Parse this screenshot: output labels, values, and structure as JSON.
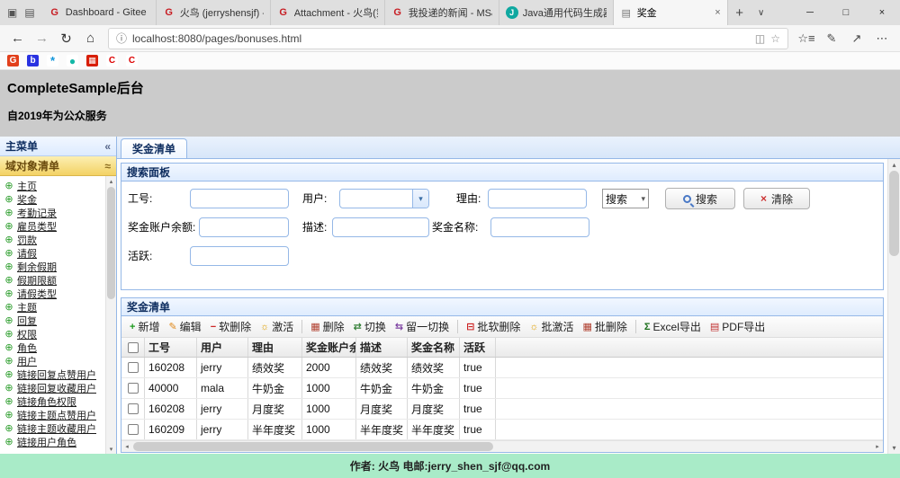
{
  "colors": {
    "accent_blue": "#95B8E7",
    "panel_header_bg": "#E0ECFF",
    "accordion_selected_bg": "#F3D264",
    "footer_bg": "#A9EBC8",
    "gitee_red": "#C71D23",
    "tree_icon_green": "#2E9E2E"
  },
  "icons": {
    "tab_preview": "▣",
    "set_aside": "▤",
    "new_tab": "+",
    "tab_menu": "∨",
    "minimize": "─",
    "maximize": "□",
    "close": "×",
    "back": "←",
    "forward": "→",
    "refresh": "↻",
    "home": "⌂",
    "info": "ⓘ",
    "reading_view": "◫",
    "star": "☆",
    "hub": "☆≡",
    "ink": "✎",
    "share": "↗",
    "more": "⋯",
    "collapse_left": "«",
    "accordion_tool": "≈",
    "tree_node": "⊕",
    "combo_arrow": "▾",
    "select_arrow": "▾",
    "clear": "×",
    "scroll_up": "▴",
    "scroll_down": "▾",
    "scroll_left": "◂",
    "scroll_right": "▸"
  },
  "browser": {
    "tabs": [
      {
        "favicon": "G",
        "title": "Dashboard - Gitee"
      },
      {
        "favicon": "G",
        "title": "火鸟 (jerryshensjf) - Git"
      },
      {
        "favicon": "G",
        "title": "Attachment - 火鸟(第三"
      },
      {
        "favicon": "G",
        "title": "我投递的新闻 - MS&A("
      },
      {
        "favicon": "J",
        "title": "Java通用代码生成器光"
      },
      {
        "favicon": "▤",
        "title": "奖金"
      }
    ],
    "url": "localhost:8080/pages/bonuses.html",
    "favorites": [
      "G",
      "b",
      "*",
      "●",
      "▦",
      "C",
      "C"
    ]
  },
  "page": {
    "header": {
      "title": "CompleteSample后台",
      "subtitle": "自2019年为公众服务"
    },
    "sidebar": {
      "panel_title": "主菜单",
      "accordion_title": "域对象清单",
      "items": [
        "主页",
        "奖金",
        "考勤记录",
        "雇员类型",
        "罚款",
        "请假",
        "剩余假期",
        "假期限额",
        "请假类型",
        "主题",
        "回复",
        "权限",
        "角色",
        "用户",
        "链接回复点赞用户",
        "链接回复收藏用户",
        "链接角色权限",
        "链接主题点赞用户",
        "链接主题收藏用户",
        "链接用户角色"
      ]
    },
    "main": {
      "tab_label": "奖金清单",
      "search": {
        "title": "搜索面板",
        "labels": {
          "emp_no": "工号:",
          "user": "用户:",
          "reason": "理由:",
          "balance": "奖金账户余额:",
          "description": "描述:",
          "bonus_name": "奖金名称:",
          "active": "活跃:"
        },
        "mode_select_value": "搜索",
        "search_button": "搜索",
        "clear_button": "清除"
      },
      "grid": {
        "title": "奖金清单",
        "toolbar": [
          {
            "icon": "+",
            "label": "新增"
          },
          {
            "icon": "✎",
            "label": "编辑"
          },
          {
            "icon": "−",
            "label": "软删除"
          },
          {
            "icon": "☼",
            "label": "激活"
          },
          {
            "icon": "▦",
            "label": "删除"
          },
          {
            "icon": "⇄",
            "label": "切换"
          },
          {
            "icon": "⇆",
            "label": "留一切换"
          },
          {
            "icon": "⊟",
            "label": "批软删除"
          },
          {
            "icon": "☼",
            "label": "批激活"
          },
          {
            "icon": "▦",
            "label": "批删除"
          },
          {
            "icon": "Σ",
            "label": "Excel导出"
          },
          {
            "icon": "▤",
            "label": "PDF导出"
          }
        ],
        "columns": [
          "工号",
          "用户",
          "理由",
          "奖金账户余额",
          "描述",
          "奖金名称",
          "活跃"
        ],
        "rows": [
          [
            "160208",
            "jerry",
            "绩效奖",
            "2000",
            "绩效奖",
            "绩效奖",
            "true"
          ],
          [
            "40000",
            "mala",
            "牛奶金",
            "1000",
            "牛奶金",
            "牛奶金",
            "true"
          ],
          [
            "160208",
            "jerry",
            "月度奖",
            "1000",
            "月度奖",
            "月度奖",
            "true"
          ],
          [
            "160209",
            "jerry",
            "半年度奖",
            "1000",
            "半年度奖",
            "半年度奖",
            "true"
          ]
        ]
      }
    },
    "footer": "作者: 火鸟 电邮:jerry_shen_sjf@qq.com"
  }
}
